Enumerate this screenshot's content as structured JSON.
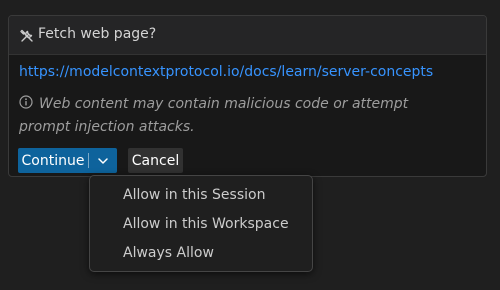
{
  "dialog": {
    "title": "Fetch web page?",
    "url": "https://modelcontextprotocol.io/docs/learn/server-concepts",
    "warning": "Web content may contain malicious code or attempt prompt injection attacks.",
    "icons": {
      "title": "tools-icon",
      "warning": "info-icon",
      "dropdown": "chevron-down-icon"
    }
  },
  "buttons": {
    "continue_label": "Continue",
    "cancel_label": "Cancel"
  },
  "menu": {
    "items": [
      {
        "label": "Allow in this Session"
      },
      {
        "label": "Allow in this Workspace"
      },
      {
        "label": "Always Allow"
      }
    ]
  },
  "colors": {
    "background": "#1f1f1f",
    "card": "#181818",
    "link": "#3794ff",
    "primary_button": "#0e639c",
    "secondary_button": "#313131",
    "warning_text": "#9d9d9d"
  }
}
